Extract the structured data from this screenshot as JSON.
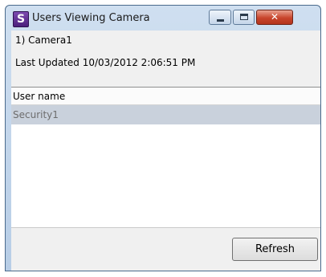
{
  "window": {
    "title": "Users Viewing Camera",
    "app_icon_letter": "S",
    "controls": {
      "minimize_icon": "minimize-icon",
      "maximize_icon": "maximize-icon",
      "close_icon": "close-icon",
      "close_glyph": "✕"
    }
  },
  "info": {
    "camera": "1) Camera1",
    "last_updated": "Last Updated 10/03/2012 2:06:51 PM"
  },
  "list": {
    "column_header": "User name",
    "rows": [
      "Security1"
    ],
    "selected_row_color": "#c9d1dc"
  },
  "buttons": {
    "refresh": "Refresh"
  },
  "colors": {
    "close_button": "#c8452c",
    "titlebar": "#b7cde6"
  }
}
